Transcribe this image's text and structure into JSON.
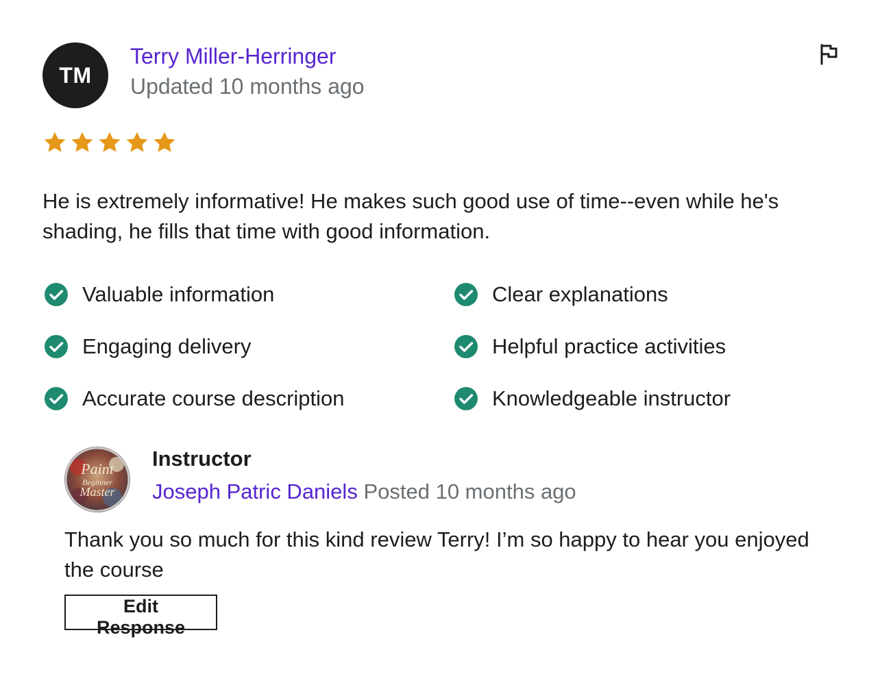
{
  "reviewer": {
    "initials": "TM",
    "name": "Terry Miller-Herringer",
    "updated": "Updated 10 months ago",
    "rating": 5,
    "rating_max": 5,
    "text": "He is extremely informative! He makes such good use of time--even while he's shading, he fills that time with good information."
  },
  "icons": {
    "report": "flag-icon",
    "star": "star-icon",
    "tag": "check-circle-icon"
  },
  "colors": {
    "link": "#5624d0",
    "star": "#e59819",
    "check": "#1e8a6f",
    "muted": "#6a6f73",
    "text": "#1c1d1f"
  },
  "tags": [
    "Valuable information",
    "Clear explanations",
    "Engaging delivery",
    "Helpful practice activities",
    "Accurate course description",
    "Knowledgeable instructor"
  ],
  "response": {
    "role": "Instructor",
    "name": "Joseph Patric Daniels",
    "posted": "Posted 10 months ago",
    "avatar_text": [
      "Paint",
      "Beginner",
      "Master"
    ],
    "text": "Thank you so much for this kind review Terry! I’m so happy to hear you enjoyed the course",
    "edit_label": "Edit Response"
  }
}
